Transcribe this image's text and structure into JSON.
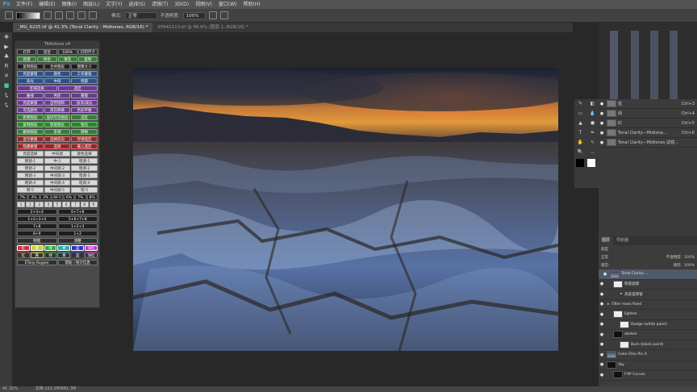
{
  "menubar": {
    "logo": "Ps",
    "items": [
      "文件(F)",
      "编辑(E)",
      "图像(I)",
      "图层(L)",
      "文字(Y)",
      "选择(S)",
      "滤镜(T)",
      "3D(D)",
      "视图(V)",
      "窗口(W)",
      "帮助(H)"
    ]
  },
  "options": {
    "mode_label": "模式:",
    "mode_value": "正常",
    "opacity_label": "不透明度:",
    "opacity_value": "100%"
  },
  "tabs": [
    {
      "label": "_MG_6225.tif @ 41.3% (Tonal Clarity - Midtones, RGB/16) *"
    },
    {
      "label": "STA41113.tif @ 66.6% (图层 1, RGB/16) *"
    }
  ],
  "tk_panel": {
    "title": "TKActions v4",
    "rows": [
      [
        {
          "t": "打开",
          "c": "gy"
        },
        {
          "t": "适合",
          "c": "gy"
        },
        {
          "t": "100%",
          "c": "gy"
        },
        {
          "t": "打印尺寸",
          "c": "gy"
        }
      ],
      [
        {
          "t": "新建",
          "c": "g"
        },
        {
          "t": "拼合",
          "c": "g"
        },
        {
          "t": "填充",
          "c": "g"
        },
        {
          "t": "复制",
          "c": "g"
        }
      ],
      [
        {
          "t": "复制图层",
          "c": "dk"
        },
        {
          "t": "合并图层",
          "c": "dk"
        },
        {
          "t": "图像大小",
          "c": "dk"
        }
      ],
      [
        {
          "t": "亮度蒙版",
          "c": "bl"
        },
        {
          "t": "颜色",
          "c": "bl"
        },
        {
          "t": "工作蒙版",
          "c": "bl"
        }
      ],
      [
        {
          "t": "高光",
          "c": "bl"
        },
        {
          "t": "中间",
          "c": "bl"
        },
        {
          "t": "暗部",
          "c": "bl"
        }
      ],
      [
        {
          "t": "区域选择",
          "c": "pu"
        },
        {
          "t": "选区",
          "c": "pu"
        }
      ],
      [
        {
          "t": "曲线",
          "c": "pu"
        },
        {
          "t": "色阶",
          "c": "pu"
        },
        {
          "t": "蒙版",
          "c": "pu"
        }
      ],
      [
        {
          "t": "亮度蒙版",
          "c": "pu"
        },
        {
          "t": "自然饱和",
          "c": "pu"
        },
        {
          "t": "加深/减淡",
          "c": "pu"
        }
      ],
      [
        {
          "t": "可选颜色",
          "c": "pu"
        },
        {
          "t": "黑白转换",
          "c": "pu"
        },
        {
          "t": "色彩平衡",
          "c": "pu"
        }
      ],
      [
        {
          "t": "新建图层",
          "c": "g"
        },
        {
          "t": "盖印可见图层",
          "c": "g"
        },
        {
          "t": "选区",
          "c": "g"
        }
      ],
      [
        {
          "t": "复制图层",
          "c": "g"
        },
        {
          "t": "智能锐化",
          "c": "g"
        },
        {
          "t": "锐化",
          "c": "g"
        }
      ],
      [
        {
          "t": "删除图层",
          "c": "g"
        },
        {
          "t": "反相",
          "c": "g"
        },
        {
          "t": "转换",
          "c": "g"
        }
      ],
      [
        {
          "t": "显示蒙版",
          "c": "rd"
        },
        {
          "t": "选择反向",
          "c": "rd"
        },
        {
          "t": "存储选区",
          "c": "rd"
        }
      ],
      [
        {
          "t": "隐藏蒙版",
          "c": "rd"
        },
        {
          "t": "选择",
          "c": "rd"
        },
        {
          "t": "载入选区",
          "c": "rd"
        }
      ]
    ],
    "tabs2": [
      "亮度选择",
      "中间调",
      "颜色选择"
    ],
    "zone_rows": [
      [
        {
          "t": "明调-1",
          "c": "lg"
        },
        {
          "t": "中-1",
          "c": "lg"
        },
        {
          "t": "暗调-1",
          "c": "lg"
        }
      ],
      [
        {
          "t": "明调-2",
          "c": "lg"
        },
        {
          "t": "中间调-2",
          "c": "lg"
        },
        {
          "t": "暗调-2",
          "c": "lg"
        }
      ],
      [
        {
          "t": "明调-3",
          "c": "lg"
        },
        {
          "t": "中间调-3",
          "c": "lg"
        },
        {
          "t": "暗调-3",
          "c": "lg"
        }
      ],
      [
        {
          "t": "明调-4",
          "c": "lg"
        },
        {
          "t": "中间调-4",
          "c": "lg"
        },
        {
          "t": "暗调-4",
          "c": "lg"
        }
      ],
      [
        {
          "t": "明-5",
          "c": "lg"
        },
        {
          "t": "中间调-5",
          "c": "lg"
        },
        {
          "t": "暗-5",
          "c": "lg"
        }
      ]
    ],
    "zones_row1": [
      "7%",
      "2%",
      "3%",
      "All-5",
      "6%",
      "7%",
      "8%"
    ],
    "zones_row2": [
      "1",
      "2",
      "3",
      "4",
      "5",
      "6",
      "7",
      "8",
      "9"
    ],
    "zones_row3": [
      "2+3+4",
      "6+7+8"
    ],
    "zones_row4": [
      "1+2+3+4",
      "5+6+7+8"
    ],
    "zones_row5": [
      "7+8",
      "1+2+3"
    ],
    "zones_row6": [
      "8+9",
      "1+2"
    ],
    "bottom_labels": [
      "明暗",
      "调整"
    ],
    "color_row": [
      "红",
      "黄",
      "绿",
      "青",
      "蓝",
      "洋红"
    ],
    "footer": [
      "ETony Kuyper",
      "帮助 / 统计信息"
    ]
  },
  "right_panel": {
    "history": [
      {
        "label": "蓝",
        "shortcut": "Ctrl+3"
      },
      {
        "label": "绿",
        "shortcut": "Ctrl+4"
      },
      {
        "label": "红",
        "shortcut": "Ctrl+5"
      },
      {
        "label": "Tonal Clarity—Midtone...",
        "shortcut": "Ctrl+6"
      },
      {
        "label": "Tonal Clarity—Midtones 滤镜...",
        "shortcut": ""
      }
    ],
    "layers_tabs": [
      "图层",
      "导航器"
    ],
    "filter_label": "类型",
    "blend_label": "正常",
    "opacity_label": "不透明度:",
    "opacity_value": "100%",
    "lock_label": "锁定:",
    "fill_label": "填充:",
    "fill_value": "100%",
    "layers": [
      {
        "name": "Tonal Clarity-...",
        "thumb": "p",
        "sel": true,
        "indent": 0
      },
      {
        "name": "智能滤镜",
        "thumb": "w",
        "sel": false,
        "indent": 1
      },
      {
        "name": "高反差保留",
        "thumb": "",
        "sel": false,
        "indent": 2
      },
      {
        "name": "Filter mass fixed",
        "thumb": "",
        "sel": false,
        "indent": 0
      },
      {
        "name": "lighten",
        "thumb": "w",
        "sel": false,
        "indent": 1
      },
      {
        "name": "Dodge (white paint)",
        "thumb": "w",
        "sel": false,
        "indent": 2
      },
      {
        "name": "darken",
        "thumb": "k",
        "sel": false,
        "indent": 1
      },
      {
        "name": "Burn (black paint)",
        "thumb": "w",
        "sel": false,
        "indent": 2
      },
      {
        "name": "Color Efex Pro 4",
        "thumb": "p",
        "sel": false,
        "indent": 0
      },
      {
        "name": "Sky",
        "thumb": "k",
        "sel": false,
        "indent": 0
      },
      {
        "name": "FHP Curves",
        "thumb": "k",
        "sel": false,
        "indent": 1
      }
    ]
  },
  "status": {
    "zoom": "41.32%",
    "doc": "文档:122.2M/681.3M"
  }
}
